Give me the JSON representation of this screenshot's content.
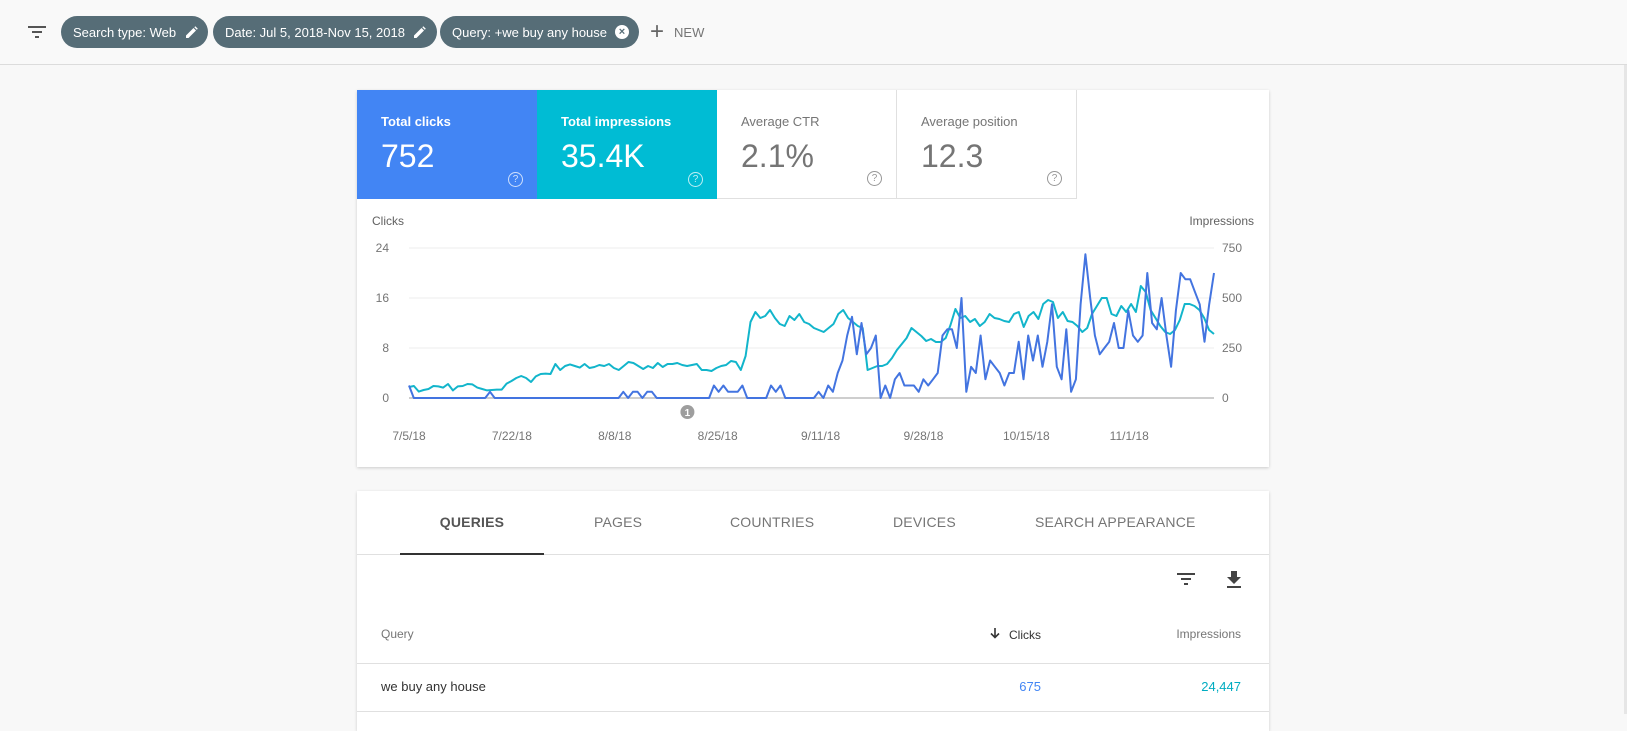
{
  "header": {
    "filter_icon": "filter-list-icon",
    "chips": [
      {
        "label": "Search type: Web",
        "icon": "pencil-icon"
      },
      {
        "label": "Date: Jul 5, 2018-Nov 15, 2018",
        "icon": "pencil-icon"
      },
      {
        "label": "Query: +we buy any house",
        "icon": "close-circle-icon"
      }
    ],
    "new_button": {
      "icon": "plus-icon",
      "label": "NEW"
    }
  },
  "metrics": [
    {
      "label": "Total clicks",
      "value": "752",
      "color": "#4285f4",
      "selected": true
    },
    {
      "label": "Total impressions",
      "value": "35.4K",
      "color": "#00bcd4",
      "selected": true
    },
    {
      "label": "Average CTR",
      "value": "2.1%",
      "selected": false
    },
    {
      "label": "Average position",
      "value": "12.3",
      "selected": false
    }
  ],
  "help_icon": "?",
  "chart_data": {
    "type": "line",
    "title": "",
    "ylabel_left": "Clicks",
    "ylabel_right": "Impressions",
    "ylim_left": [
      0,
      24
    ],
    "ylim_right": [
      0,
      750
    ],
    "yticks_left": [
      "0",
      "8",
      "16",
      "24"
    ],
    "yticks_right": [
      "0",
      "250",
      "500",
      "750"
    ],
    "xticks": [
      "7/5/18",
      "7/22/18",
      "8/8/18",
      "8/25/18",
      "9/11/18",
      "9/28/18",
      "10/15/18",
      "11/1/18"
    ],
    "x_start": "2018-07-05",
    "x_end": "2018-11-15",
    "grid": true,
    "annotation": {
      "label": "1",
      "date": "2018-08-20"
    },
    "series": [
      {
        "name": "Clicks",
        "axis": "left",
        "color": "#4374e0",
        "values": [
          2,
          0,
          0,
          0,
          0,
          0,
          0,
          0,
          0,
          0,
          0,
          0,
          0,
          0,
          0,
          0,
          0,
          1,
          0,
          0,
          0,
          0,
          0,
          0,
          0,
          0,
          0,
          0,
          0,
          0,
          0,
          0,
          0,
          0,
          0,
          0,
          0,
          0,
          0,
          0,
          0,
          0,
          0,
          0,
          0,
          1,
          0,
          1,
          1,
          0,
          1,
          1,
          0,
          0,
          0,
          0,
          0,
          0,
          0,
          0,
          0,
          0,
          0,
          0,
          2,
          1,
          2,
          1,
          1,
          1,
          2,
          0,
          0,
          0,
          0,
          0,
          2,
          1,
          2,
          0,
          0,
          0,
          0,
          0,
          0,
          0,
          1,
          0,
          2,
          1,
          4,
          6,
          10,
          13,
          7,
          12,
          7,
          8,
          10,
          0,
          2,
          0,
          3,
          4,
          2,
          2,
          2,
          1,
          3,
          2,
          3,
          4,
          10,
          11,
          11,
          8,
          16,
          1,
          5,
          4,
          10,
          3,
          6,
          5,
          4,
          2,
          4,
          4,
          9,
          3,
          10,
          6,
          10,
          5,
          9,
          15,
          5,
          3,
          11,
          1,
          3,
          15,
          23,
          16,
          10,
          7,
          8,
          9,
          12,
          8,
          8,
          14,
          10,
          9,
          10,
          20,
          12,
          11,
          16,
          10,
          5,
          14,
          20,
          19,
          19,
          17,
          15,
          9,
          15,
          20
        ],
        "note": "approximate daily values read from chart"
      },
      {
        "name": "Impressions",
        "axis": "right",
        "color": "#12b5cb",
        "values": [
          55,
          60,
          32,
          40,
          45,
          60,
          58,
          52,
          70,
          38,
          58,
          60,
          70,
          68,
          52,
          45,
          38,
          40,
          42,
          42,
          72,
          85,
          100,
          110,
          100,
          80,
          108,
          120,
          122,
          120,
          170,
          140,
          160,
          168,
          160,
          152,
          170,
          150,
          155,
          165,
          160,
          170,
          150,
          140,
          160,
          180,
          175,
          160,
          145,
          160,
          150,
          175,
          155,
          170,
          170,
          175,
          165,
          160,
          165,
          170,
          140,
          140,
          135,
          150,
          160,
          165,
          185,
          180,
          140,
          210,
          380,
          430,
          400,
          410,
          440,
          400,
          370,
          360,
          410,
          390,
          420,
          380,
          370,
          350,
          340,
          330,
          350,
          370,
          420,
          440,
          400,
          380,
          360,
          350,
          140,
          150,
          160,
          160,
          170,
          200,
          240,
          270,
          300,
          350,
          330,
          310,
          285,
          295,
          280,
          280,
          300,
          365,
          445,
          400,
          410,
          380,
          395,
          360,
          380,
          420,
          400,
          395,
          385,
          380,
          420,
          430,
          355,
          410,
          430,
          395,
          470,
          490,
          480,
          400,
          430,
          385,
          380,
          360,
          330,
          350,
          420,
          460,
          500,
          500,
          420,
          410,
          460,
          430,
          470,
          430,
          560,
          530,
          440,
          400,
          360,
          330,
          320,
          340,
          390,
          470,
          470,
          460,
          440,
          400,
          340,
          320
        ],
        "note": "approximate daily values read from chart"
      }
    ]
  },
  "tabs": [
    {
      "label": "QUERIES",
      "active": true
    },
    {
      "label": "PAGES",
      "active": false
    },
    {
      "label": "COUNTRIES",
      "active": false
    },
    {
      "label": "DEVICES",
      "active": false
    },
    {
      "label": "SEARCH APPEARANCE",
      "active": false
    }
  ],
  "table": {
    "tools": {
      "filter_icon": "filter-list-icon",
      "download_icon": "download-icon"
    },
    "columns": [
      {
        "label": "Query"
      },
      {
        "label": "Clicks",
        "sorted": "descending",
        "sort_icon": "arrow-down-icon"
      },
      {
        "label": "Impressions"
      }
    ],
    "rows": [
      {
        "query": "we buy any house",
        "clicks": "675",
        "impressions": "24,447"
      }
    ],
    "clicks_color": "#4285f4",
    "impressions_color": "#00acc1"
  }
}
